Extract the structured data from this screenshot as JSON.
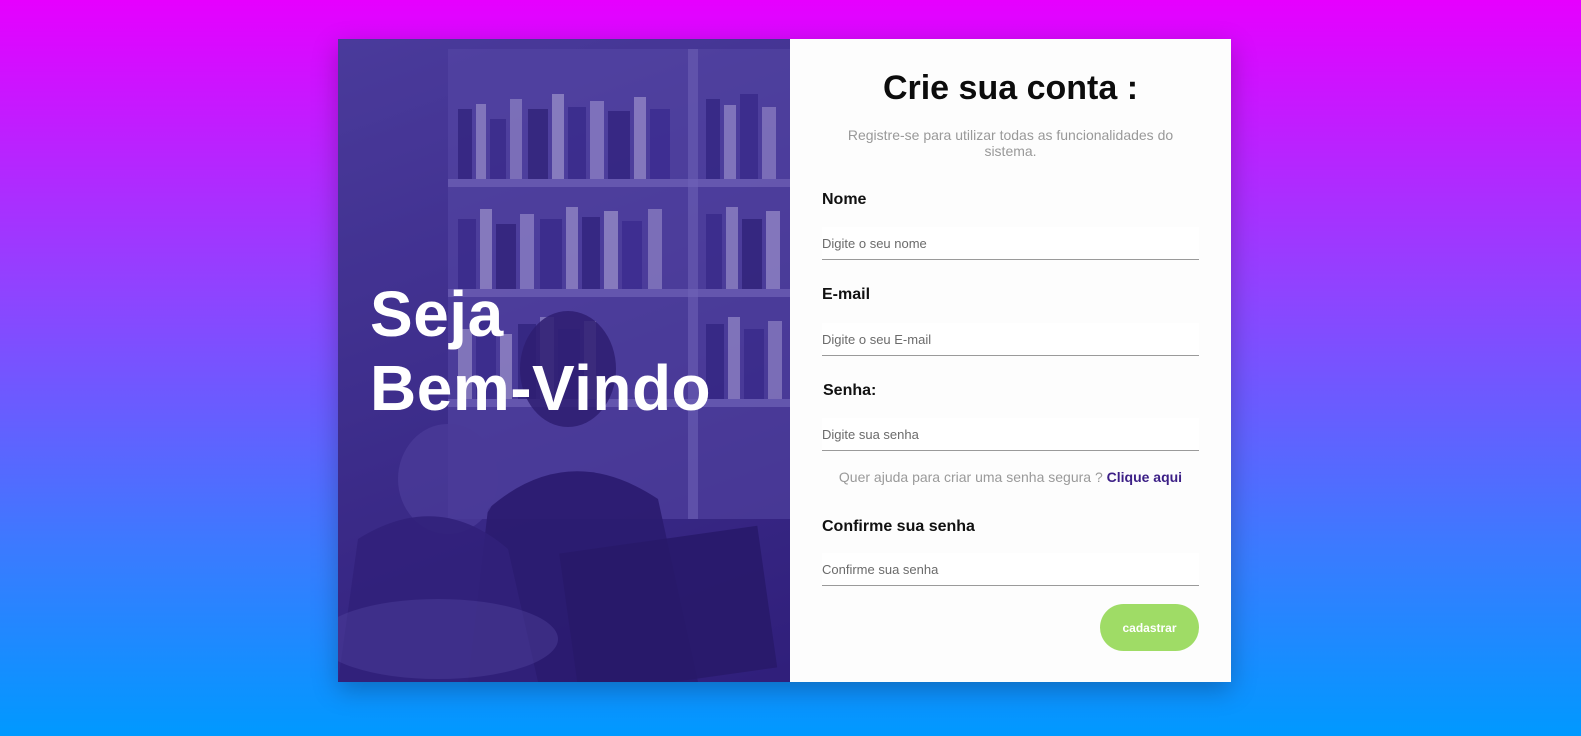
{
  "hero": {
    "line1": "Seja",
    "line2": "Bem-Vindo"
  },
  "form": {
    "title": "Crie sua conta :",
    "subtitle": "Registre-se para utilizar todas as funcionalidades do sistema.",
    "fields": {
      "name": {
        "label": "Nome",
        "placeholder": "Digite o seu nome",
        "value": ""
      },
      "email": {
        "label": "E-mail",
        "placeholder": "Digite o seu E-mail",
        "value": ""
      },
      "password": {
        "label": "Senha:",
        "placeholder": "Digite sua senha",
        "value": ""
      },
      "confirm": {
        "label": "Confirme sua senha",
        "placeholder": "Confirme sua senha",
        "value": ""
      }
    },
    "help_text": "Quer ajuda para criar uma senha segura ?",
    "help_link": "Clique aqui",
    "submit_label": "cadastrar"
  },
  "colors": {
    "background_top": "#e600ff",
    "background_bottom": "#0099ff",
    "overlay": "#4b3b94",
    "button": "#9fdc66",
    "link": "#3c1f86"
  },
  "icons": [
    "library-photo-image"
  ]
}
